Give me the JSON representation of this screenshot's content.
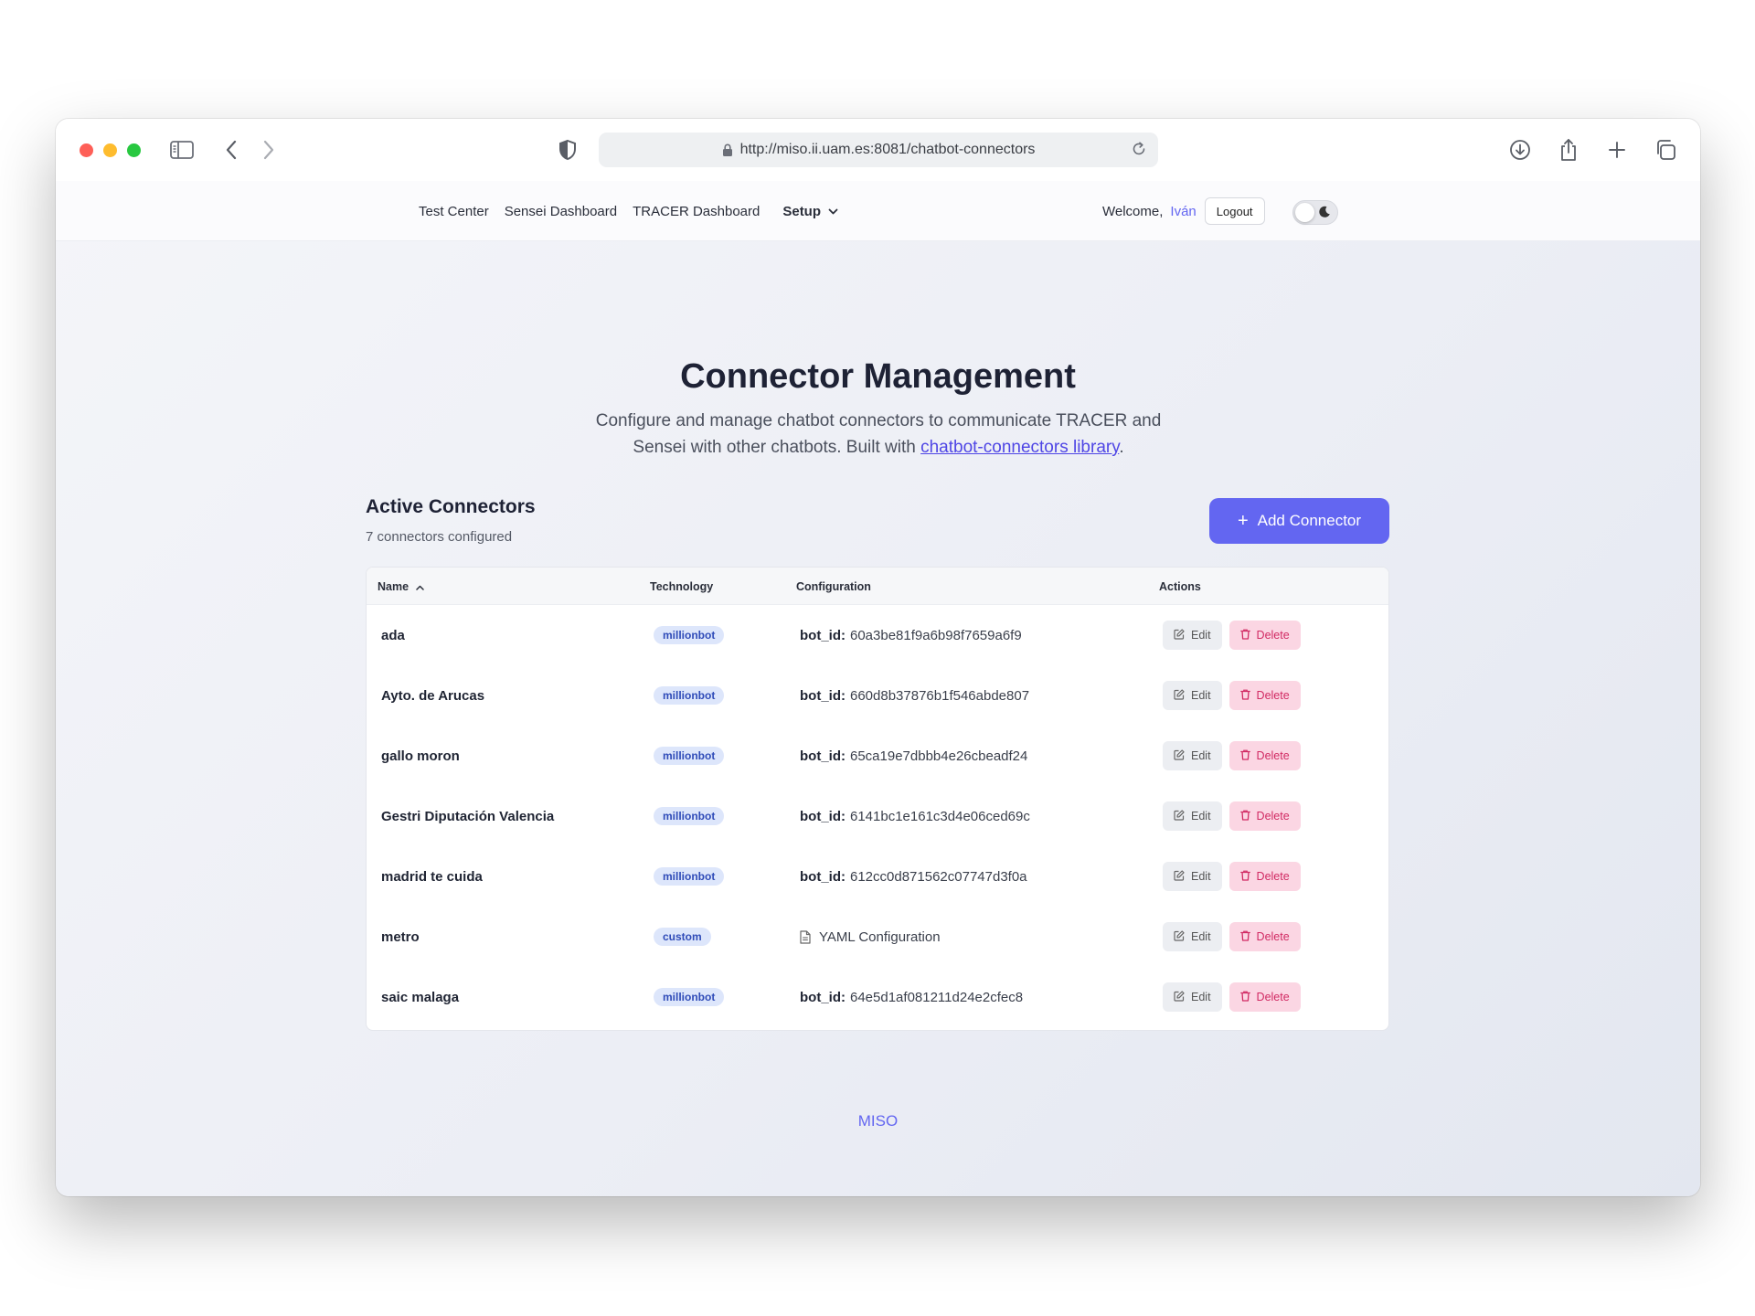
{
  "browser": {
    "url": "http://miso.ii.uam.es:8081/chatbot-connectors"
  },
  "nav": {
    "links": [
      "Test Center",
      "Sensei Dashboard",
      "TRACER Dashboard"
    ],
    "setup": "Setup",
    "welcome": "Welcome,",
    "user": "Iván",
    "logout": "Logout"
  },
  "hero": {
    "title": "Connector Management",
    "subtitle_before": "Configure and manage chatbot connectors to communicate TRACER and Sensei with other chatbots. Built with ",
    "subtitle_link": "chatbot-connectors library",
    "subtitle_after": "."
  },
  "section": {
    "title": "Active Connectors",
    "count": "7 connectors configured",
    "add_button": "Add Connector"
  },
  "table": {
    "columns": [
      "Name",
      "Technology",
      "Configuration",
      "Actions"
    ],
    "edit_label": "Edit",
    "delete_label": "Delete",
    "rows": [
      {
        "name": "ada",
        "technology": "millionbot",
        "config_key": "bot_id:",
        "config_value": "60a3be81f9a6b98f7659a6f9"
      },
      {
        "name": "Ayto. de Arucas",
        "technology": "millionbot",
        "config_key": "bot_id:",
        "config_value": "660d8b37876b1f546abde807"
      },
      {
        "name": "gallo moron",
        "technology": "millionbot",
        "config_key": "bot_id:",
        "config_value": "65ca19e7dbbb4e26cbeadf24"
      },
      {
        "name": "Gestri Diputación Valencia",
        "technology": "millionbot",
        "config_key": "bot_id:",
        "config_value": "6141bc1e161c3d4e06ced69c"
      },
      {
        "name": "madrid te cuida",
        "technology": "millionbot",
        "config_key": "bot_id:",
        "config_value": "612cc0d871562c07747d3f0a"
      },
      {
        "name": "metro",
        "technology": "custom",
        "config_key": "",
        "config_value": "YAML Configuration"
      },
      {
        "name": "saic malaga",
        "technology": "millionbot",
        "config_key": "bot_id:",
        "config_value": "64e5d1af081211d24e2cfec8"
      }
    ]
  },
  "footer": "MISO",
  "colors": {
    "accent": "#6366f1",
    "badge_bg": "#dde6fb",
    "delete_bg": "#fbd6e3",
    "delete_text": "#d12a63"
  }
}
